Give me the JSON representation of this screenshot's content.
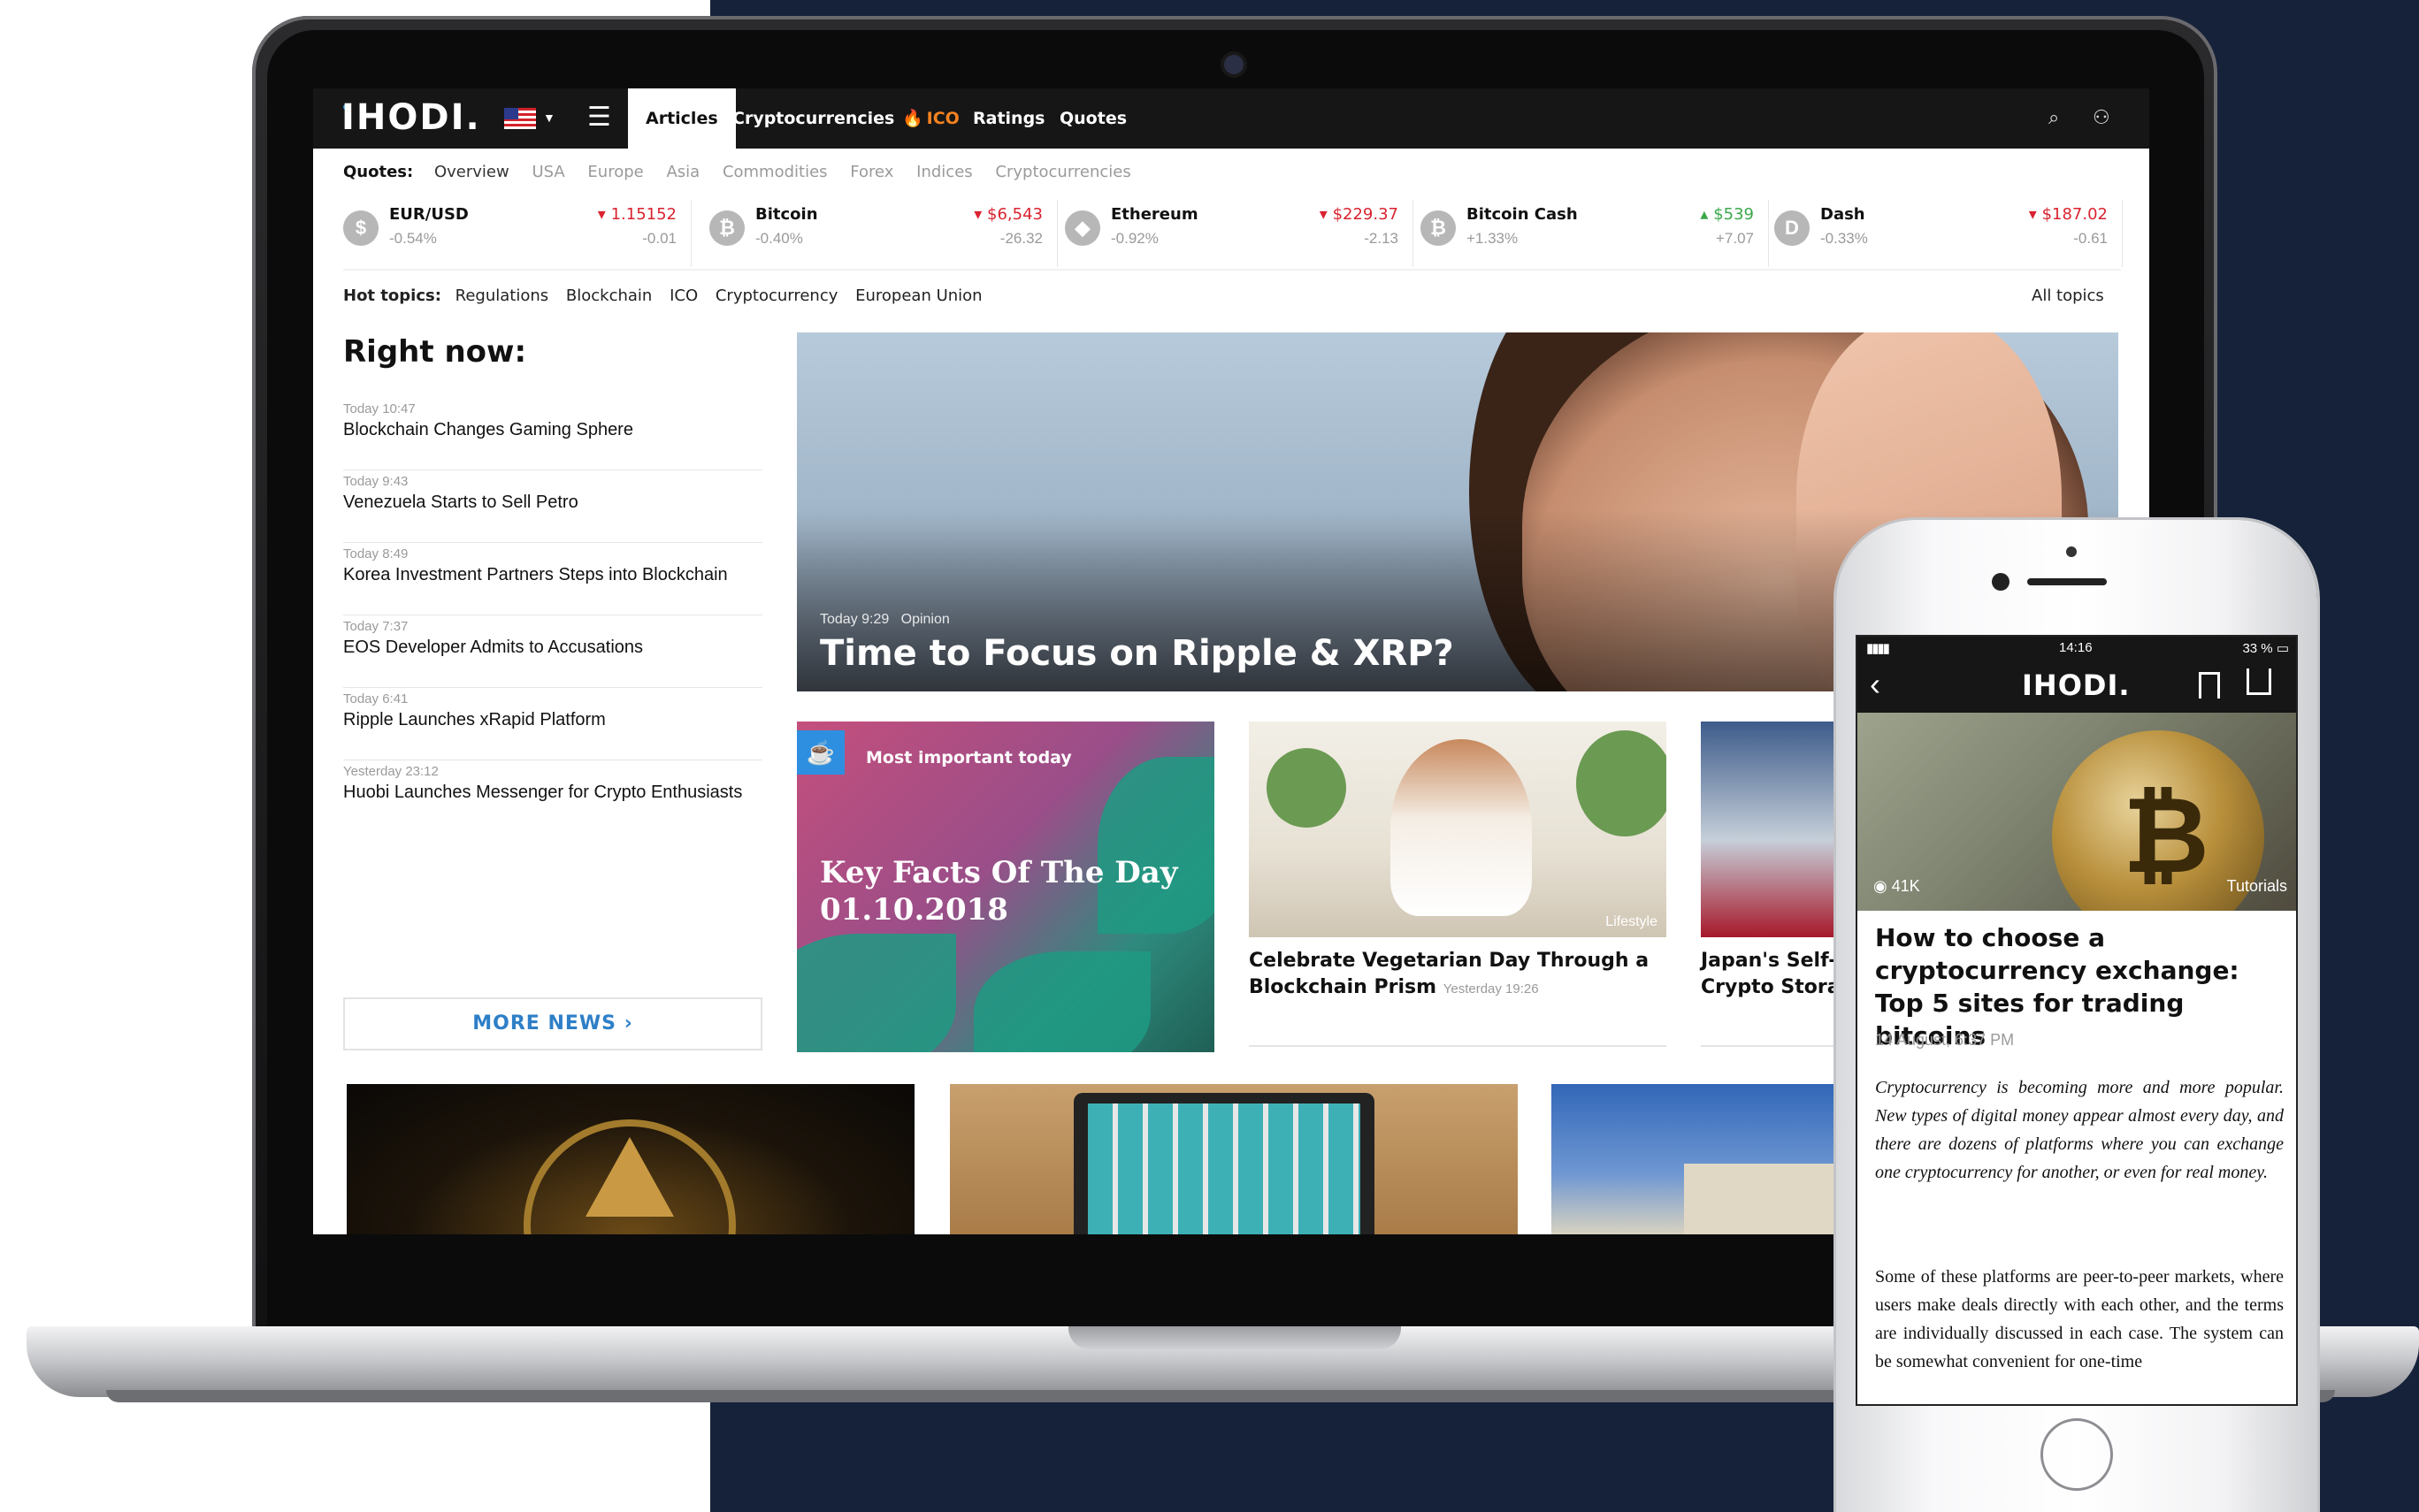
{
  "brand": {
    "name": "IHODI.",
    "flag": "US"
  },
  "nav": {
    "tabs": [
      {
        "label": "Articles",
        "active": true
      },
      {
        "label": "Cryptocurrencies"
      },
      {
        "label": "ICO",
        "icon": "flame-icon"
      },
      {
        "label": "Ratings"
      },
      {
        "label": "Quotes"
      }
    ],
    "right_icons": [
      "search-icon",
      "user-icon"
    ]
  },
  "quotes_bar": {
    "label": "Quotes:",
    "tabs": [
      "Overview",
      "USA",
      "Europe",
      "Asia",
      "Commodities",
      "Forex",
      "Indices",
      "Cryptocurrencies"
    ],
    "active": "Overview"
  },
  "tickers": [
    {
      "name": "EUR/USD",
      "pct": "-0.54%",
      "price": "1.15152",
      "change": "-0.01",
      "direction": "down"
    },
    {
      "name": "Bitcoin",
      "pct": "-0.40%",
      "price": "$6,543",
      "change": "-26.32",
      "direction": "down"
    },
    {
      "name": "Ethereum",
      "pct": "-0.92%",
      "price": "$229.37",
      "change": "-2.13",
      "direction": "down"
    },
    {
      "name": "Bitcoin Cash",
      "pct": "+1.33%",
      "price": "$539",
      "change": "+7.07",
      "direction": "up"
    },
    {
      "name": "Dash",
      "pct": "-0.33%",
      "price": "$187.02",
      "change": "-0.61",
      "direction": "down"
    }
  ],
  "hot_topics": {
    "label": "Hot topics:",
    "items": [
      "Regulations",
      "Blockchain",
      "ICO",
      "Cryptocurrency",
      "European Union"
    ],
    "all": "All topics"
  },
  "right_now": {
    "heading": "Right now:",
    "items": [
      {
        "time": "Today 10:47",
        "title": "Blockchain Changes Gaming Sphere"
      },
      {
        "time": "Today 9:43",
        "title": "Venezuela Starts to Sell Petro"
      },
      {
        "time": "Today 8:49",
        "title": "Korea Investment Partners Steps into Blockchain"
      },
      {
        "time": "Today 7:37",
        "title": "EOS Developer Admits to Accusations"
      },
      {
        "time": "Today 6:41",
        "title": "Ripple Launches xRapid Platform"
      },
      {
        "time": "Yesterday 23:12",
        "title": "Huobi Launches Messenger for Crypto Enthusiasts"
      }
    ],
    "more": "MORE NEWS"
  },
  "hero": {
    "time": "Today 9:29",
    "category": "Opinion",
    "title": "Time to Focus on Ripple & XRP?"
  },
  "cards": [
    {
      "badge": "Most important today",
      "title": "Key Facts Of The Day 01.10.2018"
    },
    {
      "tag": "Lifestyle",
      "title": "Celebrate Vegetarian Day Through a Blockchain Prism",
      "time": "Yesterday 19:26"
    },
    {
      "title_line1": "Japan's Self-R",
      "title_line2": "Crypto Storag"
    }
  ],
  "phone": {
    "status": {
      "time": "14:16",
      "battery": "33 %"
    },
    "logo": "IHODI.",
    "views": "41K",
    "category": "Tutorials",
    "title": "How to choose a cryptocurrency exchange: Top 5 sites for trading bitcoins",
    "date": "14 August, 6:37 PM",
    "paragraph1": "Cryptocurrency is becoming more and more popular. New types of digital money appear almost every day, and there are dozens of platforms where you can exchange one cryptocurrency for another, or even for real money.",
    "paragraph2": "Some of these platforms are peer-to-peer markets, where users make deals directly with each other, and the terms are individually discussed in each case. The system can be somewhat convenient for one-time"
  },
  "colors": {
    "accent": "#2e7fc7",
    "down": "#d9232f",
    "up": "#3aa84a",
    "ico": "#f58220",
    "backdrop": "#16223a"
  }
}
